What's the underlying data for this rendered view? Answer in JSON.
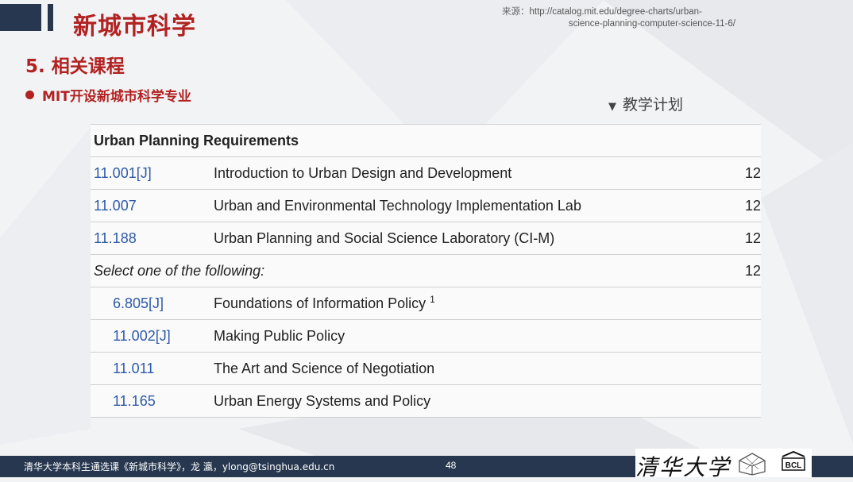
{
  "header": {
    "deck_title": "新城市科学",
    "source_label": "来源：",
    "source_line1": "http://catalog.mit.edu/degree-charts/urban-",
    "source_line2": "science-planning-computer-science-11-6/"
  },
  "section_title": "5. 相关课程",
  "bullet_text": "MIT开设新城市科学专业",
  "plan_toggle": {
    "icon": "triangle-down-icon",
    "label": "教学计划"
  },
  "table": {
    "heading": "Urban Planning Requirements",
    "rows": [
      {
        "code": "11.001[J]",
        "title": "Introduction to Urban Design and Development",
        "units": "12"
      },
      {
        "code": "11.007",
        "title": "Urban and Environmental Technology Implementation Lab",
        "units": "12"
      },
      {
        "code": "11.188",
        "title": "Urban Planning and Social Science Laboratory (CI-M)",
        "units": "12"
      }
    ],
    "select_text": "Select one of the following:",
    "select_units": "12",
    "options": [
      {
        "code": "6.805[J]",
        "title": "Foundations of Information Policy",
        "footnote": "1"
      },
      {
        "code": "11.002[J]",
        "title": "Making Public Policy"
      },
      {
        "code": "11.011",
        "title": "The Art and Science of Negotiation"
      },
      {
        "code": "11.165",
        "title": "Urban Energy Systems and Policy"
      }
    ]
  },
  "footer": {
    "text": "清华大学本科生通选课《新城市科学》，龙 瀛，ylong@tsinghua.edu.cn",
    "page_number": "48",
    "university_logo": "清华大学",
    "lab_logo": "BCL"
  },
  "colors": {
    "accent": "#b22222",
    "navy": "#26374f",
    "link": "#2e5aa8"
  }
}
